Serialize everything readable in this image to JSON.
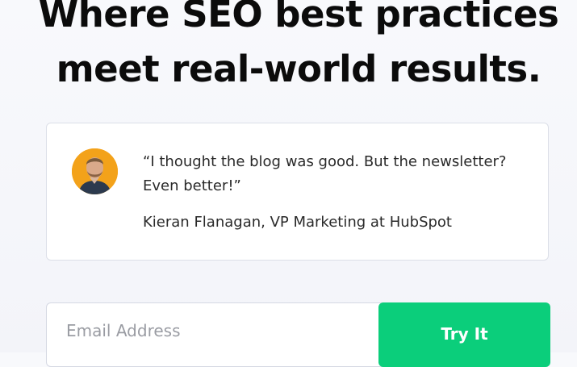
{
  "hero": {
    "headline_line1": "Where SEO best practices",
    "headline_line2": "meet real-world results."
  },
  "testimonial": {
    "quote_line1": "“I thought the blog was good. But the newsletter?",
    "quote_line2": "Even better!”",
    "author": "Kieran Flanagan, VP Marketing at HubSpot"
  },
  "signup": {
    "email_placeholder": "Email Address",
    "email_value": "",
    "button_label": "Try It"
  },
  "colors": {
    "button_bg": "#0bce7b",
    "avatar_bg": "#f3a21a",
    "headline": "#0b0b0b"
  }
}
